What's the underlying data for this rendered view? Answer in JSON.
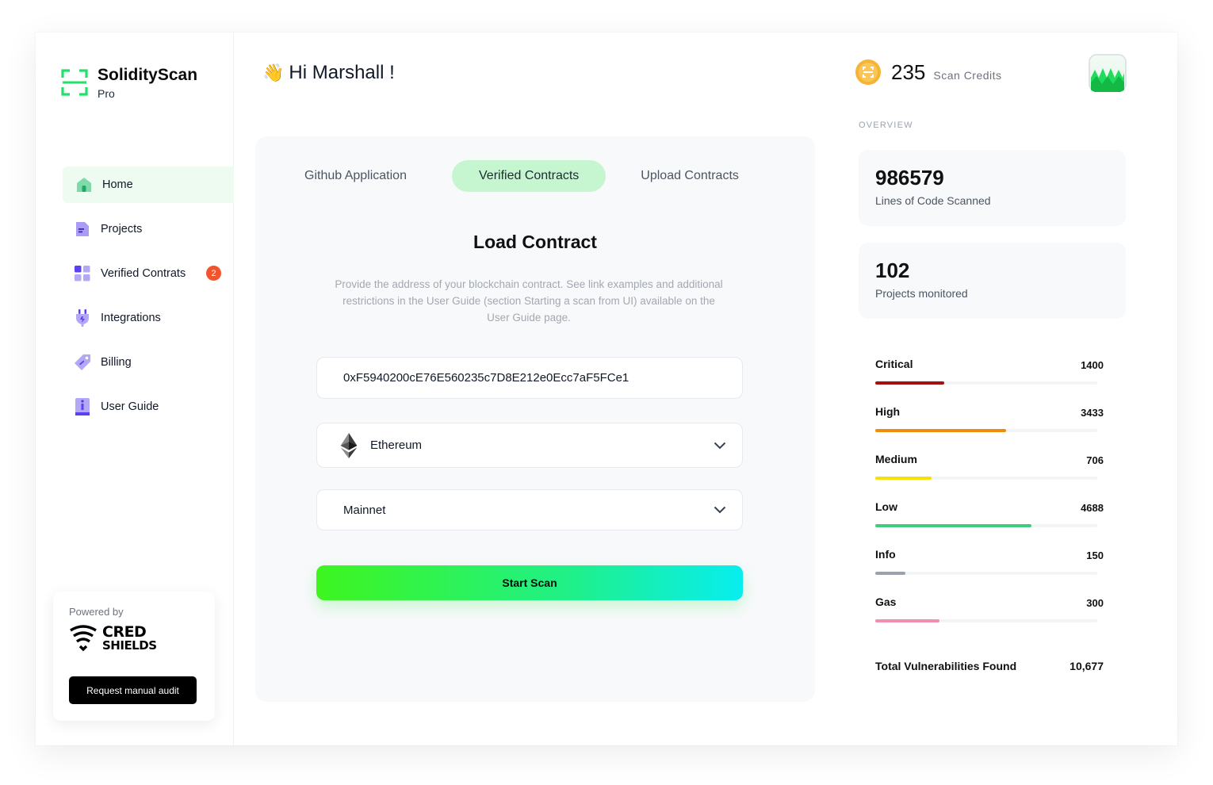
{
  "brand": {
    "name": "SolidityScan",
    "tier": "Pro",
    "accent": "#3ef51f"
  },
  "sidebar": {
    "items": [
      {
        "label": "Home",
        "icon": "home-icon",
        "active": true
      },
      {
        "label": "Projects",
        "icon": "document-icon"
      },
      {
        "label": "Verified Contrats",
        "icon": "grid-icon",
        "badge": "2"
      },
      {
        "label": "Integrations",
        "icon": "plug-icon"
      },
      {
        "label": "Billing",
        "icon": "tag-icon"
      },
      {
        "label": "User Guide",
        "icon": "info-book-icon"
      }
    ],
    "powered_by": "Powered by",
    "partner_line1": "CRED",
    "partner_line2": "SHIELDS",
    "audit_button": "Request manual audit"
  },
  "header": {
    "greeting": "Hi Marshall !",
    "credits_value": "235",
    "credits_label": "Scan Credits"
  },
  "panel": {
    "tabs": [
      {
        "label": "Github Application"
      },
      {
        "label": "Verified Contracts",
        "active": true
      },
      {
        "label": "Upload Contracts"
      }
    ],
    "title": "Load Contract",
    "description": "Provide the address of your blockchain contract. See link examples and additional restrictions in the User Guide (section Starting a scan from UI) available on the User Guide page.",
    "address_value": "0xF5940200cE76E560235c7D8E212e0Ecc7aF5FCe1",
    "chain_value": "Ethereum",
    "network_value": "Mainnet",
    "start_button": "Start Scan"
  },
  "overview": {
    "label": "OVERVIEW",
    "lines_value": "986579",
    "lines_label": "Lines of Code Scanned",
    "projects_value": "102",
    "projects_label": "Projects monitored",
    "severities": [
      {
        "name": "Critical",
        "count": "1400",
        "fraction": 0.31,
        "color": "#a50f0f"
      },
      {
        "name": "High",
        "count": "3433",
        "fraction": 0.59,
        "color": "#f08c0c"
      },
      {
        "name": "Medium",
        "count": "706",
        "fraction": 0.255,
        "color": "#f5e10a"
      },
      {
        "name": "Low",
        "count": "4688",
        "fraction": 0.705,
        "color": "#3fcc7e"
      },
      {
        "name": "Info",
        "count": "150",
        "fraction": 0.135,
        "color": "#9aa3ad"
      },
      {
        "name": "Gas",
        "count": "300",
        "fraction": 0.29,
        "color": "#f08fb0"
      }
    ],
    "total_label": "Total Vulnerabilities Found",
    "total_value": "10,677"
  }
}
